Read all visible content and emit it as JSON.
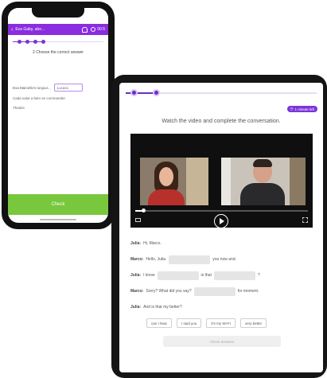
{
  "phone": {
    "header": {
      "title": "Eva Gaby, abo...",
      "timer": "00:5"
    },
    "question": "2 Choose the correct answer",
    "sentence_prefix": "Eva Marcello's tonjour...",
    "select_value": "Lucas1",
    "line2": "Cada salut a bien se commander",
    "line3": "Thanks",
    "button_label": "Check",
    "progress": {
      "dots": 4,
      "current": 3
    }
  },
  "tablet": {
    "badge": "1 minute left",
    "title": "Watch the video and complete the conversation.",
    "video": {
      "progress_fraction": 0.05
    },
    "dialog": [
      {
        "speaker": "Julia:",
        "parts": [
          "Hi, Marco."
        ]
      },
      {
        "speaker": "Marco:",
        "parts": [
          "Hello, Julia.",
          "___",
          "you now and."
        ]
      },
      {
        "speaker": "Julia:",
        "parts": [
          "I know",
          "___",
          "is that",
          "___",
          "?"
        ]
      },
      {
        "speaker": "Marco:",
        "parts": [
          "Sorry? What did you say?",
          "___",
          "for moment."
        ]
      },
      {
        "speaker": "Julia:",
        "parts": [
          "And is that my better?"
        ]
      }
    ],
    "choices": [
      "can I hear",
      "I said you",
      "It's my Wi-Fi",
      "very better"
    ],
    "check_label": "Check answers"
  }
}
